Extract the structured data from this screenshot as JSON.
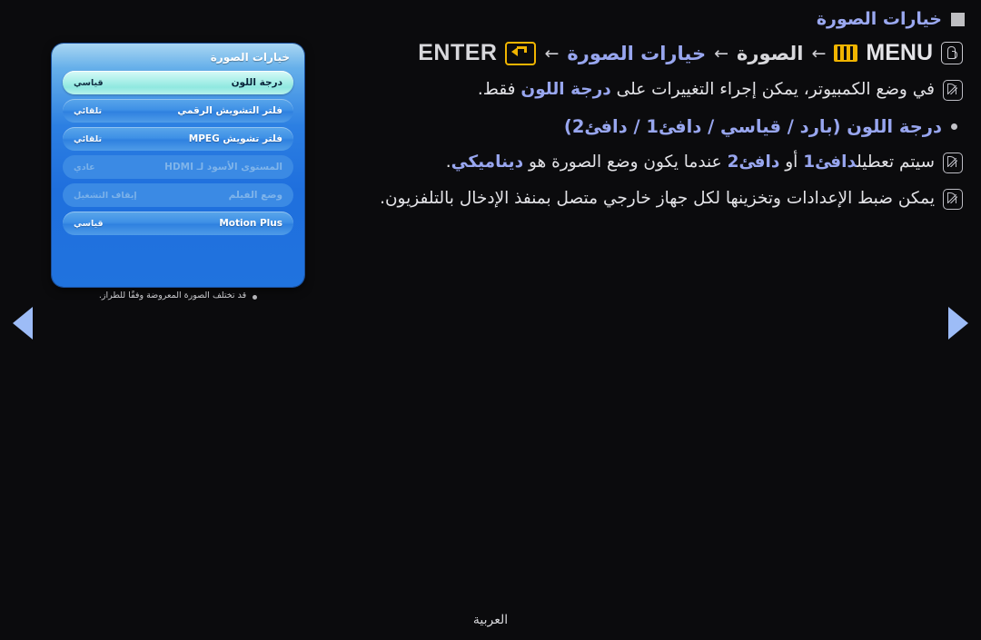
{
  "page": {
    "title": "خيارات الصورة",
    "language_footer": "العربية"
  },
  "breadcrumb": {
    "touch_icon": "hand-touch-icon",
    "menu_label": "MENU",
    "menu_icon": "menu-bars-icon",
    "arrow": "←",
    "step_picture": "الصورة",
    "step_picture_options": "خيارات الصورة",
    "enter_label": "ENTER",
    "enter_icon": "enter-return-icon"
  },
  "osd": {
    "header": "خيارات الصورة",
    "rows": [
      {
        "label": "درجة اللون",
        "value": "قياسي",
        "state": "selected"
      },
      {
        "label": "فلتر التشويش الرقمي",
        "value": "تلقائي",
        "state": "normal"
      },
      {
        "label": "فلتر تشويش MPEG",
        "value": "تلقائي",
        "state": "normal"
      },
      {
        "label": "المستوى الأسود لـ HDMI",
        "value": "عادي",
        "state": "disabled"
      },
      {
        "label": "وضع الفيلم",
        "value": "إيقاف التشغيل",
        "state": "disabled"
      },
      {
        "label": "Motion Plus",
        "value": "قياسي",
        "state": "normal"
      }
    ],
    "caption": "قد تختلف الصورة المعروضة وفقًا للطراز."
  },
  "notes": [
    {
      "icon": "note-pencil-icon",
      "parts": [
        {
          "text": "في وضع الكمبيوتر، يمكن إجراء التغييرات على ",
          "bold": false
        },
        {
          "text": "درجة اللون",
          "bold": true
        },
        {
          "text": " فقط.",
          "bold": false
        }
      ]
    }
  ],
  "bullets": [
    {
      "marker": "bullet-dot",
      "text": "درجة اللون (بارد / قياسي / دافئ1 / دافئ2)"
    }
  ],
  "notes2": [
    {
      "icon": "note-pencil-icon",
      "parts": [
        {
          "text": "سيتم تعطيل",
          "bold": false
        },
        {
          "text": "دافئ1",
          "bold": true
        },
        {
          "text": " أو ",
          "bold": false
        },
        {
          "text": "دافئ2",
          "bold": true
        },
        {
          "text": " عندما يكون وضع الصورة هو ",
          "bold": false
        },
        {
          "text": "ديناميكي",
          "bold": true
        },
        {
          "text": ".",
          "bold": false
        }
      ]
    },
    {
      "icon": "note-pencil-icon",
      "parts": [
        {
          "text": "يمكن ضبط الإعدادات وتخزينها لكل جهاز خارجي متصل بمنفذ الإدخال بالتلفزيون.",
          "bold": false
        }
      ]
    }
  ],
  "nav": {
    "prev_icon": "nav-prev-triangle-icon",
    "next_icon": "nav-next-triangle-icon"
  },
  "colors": {
    "background": "#0b0b0d",
    "accent_blue": "#98a6ef",
    "menu_yellow": "#f0b400",
    "osd_blue": "#2c7fe2",
    "osd_selected": "#aef0ea",
    "nav_arrow": "#9dbcf7"
  }
}
